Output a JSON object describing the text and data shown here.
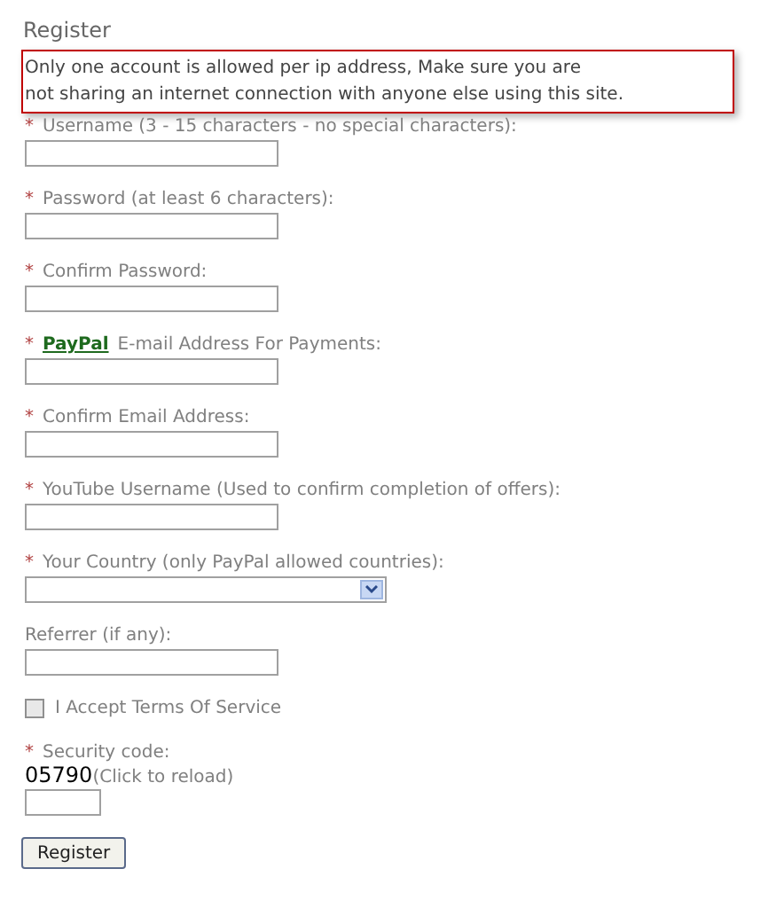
{
  "title": "Register",
  "notice": [
    "Only one account is allowed per ip address, Make sure you are",
    "not sharing an internet connection with anyone else using this site."
  ],
  "fields": [
    {
      "kind": "text",
      "marker": "*",
      "label": "Username (3 - 15 characters - no special characters):"
    },
    {
      "kind": "text",
      "marker": "*",
      "label": "Password (at least 6 characters):"
    },
    {
      "kind": "text",
      "marker": "*",
      "label": "Confirm Password:"
    },
    {
      "kind": "text",
      "marker": "*",
      "link": "PayPal",
      "label": "E-mail Address For Payments:"
    },
    {
      "kind": "text",
      "marker": "*",
      "label": "Confirm Email Address:"
    },
    {
      "kind": "text",
      "marker": "*",
      "label": "YouTube Username (Used to confirm completion of offers):"
    },
    {
      "kind": "select",
      "marker": "*",
      "label": "Your Country (only PayPal allowed countries):"
    },
    {
      "kind": "text",
      "label": "Referrer (if any):"
    },
    {
      "kind": "checkbox",
      "checked": false,
      "label": "I Accept Terms Of Service"
    },
    {
      "kind": "captcha",
      "marker": "*",
      "label": "Security code:",
      "code": "05790",
      "reload": "(Click to reload)"
    }
  ],
  "submit": "Register"
}
